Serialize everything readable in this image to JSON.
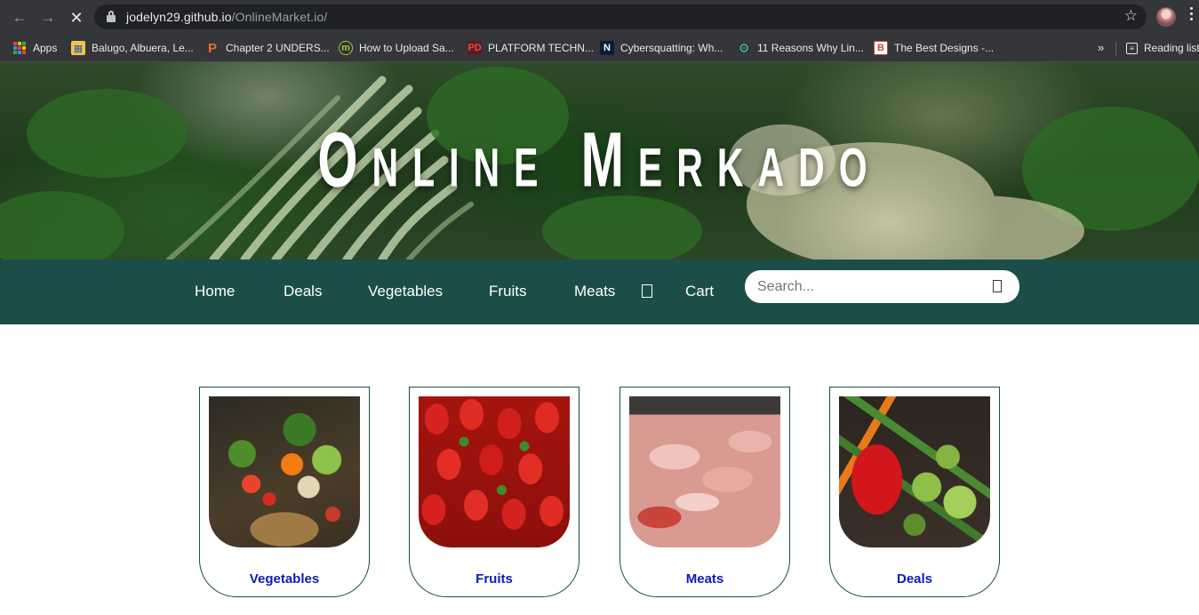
{
  "browser": {
    "url_host": "jodelyn29.github.io",
    "url_path": "/OnlineMarket.io/",
    "bookmarks": [
      {
        "label": "Apps",
        "icon": "apps-grid-icon"
      },
      {
        "label": "Balugo, Albuera, Le...",
        "icon": "map-icon"
      },
      {
        "label": "Chapter 2 UNDERS...",
        "icon": "p-logo-icon"
      },
      {
        "label": "How to Upload Sa...",
        "icon": "m-logo-icon"
      },
      {
        "label": "PLATFORM TECHN...",
        "icon": "pd-logo-icon"
      },
      {
        "label": "Cybersquatting: Wh...",
        "icon": "n-logo-icon"
      },
      {
        "label": "11 Reasons Why Lin...",
        "icon": "gear-logo-icon"
      },
      {
        "label": "The Best Designs -...",
        "icon": "b-logo-icon"
      }
    ],
    "reading_list": "Reading list",
    "overflow_chevron": "»"
  },
  "hero": {
    "title": "Online Merkado"
  },
  "navbar": {
    "links": [
      "Home",
      "Deals",
      "Vegetables",
      "Fruits",
      "Meats"
    ],
    "cart": "Cart",
    "search_placeholder": "Search..."
  },
  "categories": [
    {
      "label": "Vegetables",
      "image": "vegetables-basket"
    },
    {
      "label": "Fruits",
      "image": "strawberries"
    },
    {
      "label": "Meats",
      "image": "raw-meat"
    },
    {
      "label": "Deals",
      "image": "mixed-vegetables"
    }
  ],
  "colors": {
    "navbar_bg": "#1b4e49",
    "card_border": "#1b4e49",
    "category_label": "#0d1ab8",
    "hero_title": "#ffffff"
  }
}
